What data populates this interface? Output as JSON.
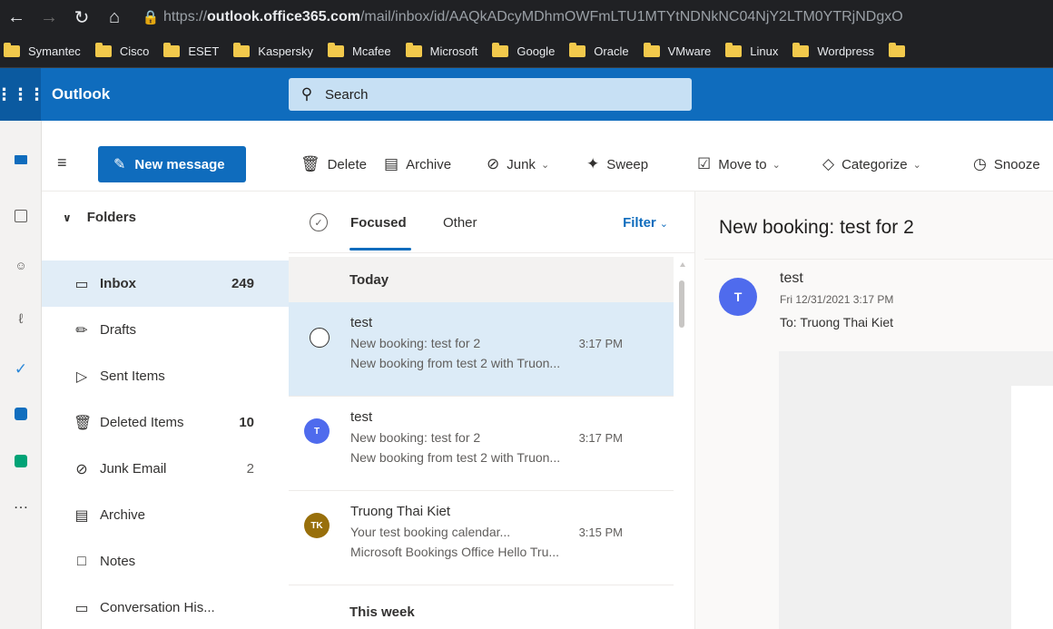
{
  "browser": {
    "url_scheme": "https://",
    "url_host": "outlook.office365.com",
    "url_path": "/mail/inbox/id/AAQkADcyMDhmOWFmLTU1MTYtNDNkNC04NjY2LTM0YTRjNDgxO"
  },
  "bookmarks": [
    "Symantec",
    "Cisco",
    "ESET",
    "Kaspersky",
    "Mcafee",
    "Microsoft",
    "Google",
    "Oracle",
    "VMware",
    "Linux",
    "Wordpress"
  ],
  "header": {
    "app_name": "Outlook",
    "search_placeholder": "Search",
    "brand_color": "#0f6cbd"
  },
  "toolbar": {
    "new_message": "New message",
    "delete": "Delete",
    "archive": "Archive",
    "junk": "Junk",
    "sweep": "Sweep",
    "move_to": "Move to",
    "categorize": "Categorize",
    "snooze": "Snooze"
  },
  "folders": {
    "title": "Folders",
    "items": [
      {
        "name": "Inbox",
        "count": "249",
        "icon": "inbox-icon"
      },
      {
        "name": "Drafts",
        "count": "",
        "icon": "pencil-icon"
      },
      {
        "name": "Sent Items",
        "count": "",
        "icon": "send-icon"
      },
      {
        "name": "Deleted Items",
        "count": "10",
        "icon": "trash-icon"
      },
      {
        "name": "Junk Email",
        "count": "2",
        "icon": "blocked-icon"
      },
      {
        "name": "Archive",
        "count": "",
        "icon": "archive-icon"
      },
      {
        "name": "Notes",
        "count": "",
        "icon": "note-icon"
      },
      {
        "name": "Conversation His...",
        "count": "",
        "icon": "folder-icon"
      }
    ]
  },
  "message_list": {
    "tabs": [
      "Focused",
      "Other"
    ],
    "filter": "Filter",
    "groups": [
      "Today",
      "This week"
    ],
    "messages": [
      {
        "from": "test",
        "subject": "New booking: test for 2",
        "time": "3:17 PM",
        "preview": "New booking from test 2 with Truon...",
        "avatar": ""
      },
      {
        "from": "test",
        "subject": "New booking: test for 2",
        "time": "3:17 PM",
        "preview": "New booking from test 2 with Truon...",
        "avatar": "T",
        "avatar_color": "#4f6bed"
      },
      {
        "from": "Truong Thai Kiet",
        "subject": "Your test booking calendar...",
        "time": "3:15 PM",
        "preview": "Microsoft Bookings Office Hello Tru...",
        "avatar": "TK",
        "avatar_color": "#986f0b"
      }
    ]
  },
  "reading_pane": {
    "title": "New booking: test for 2",
    "avatar": "T",
    "from": "test",
    "date": "Fri 12/31/2021 3:17 PM",
    "to": "To:  Truong Thai Kiet"
  }
}
